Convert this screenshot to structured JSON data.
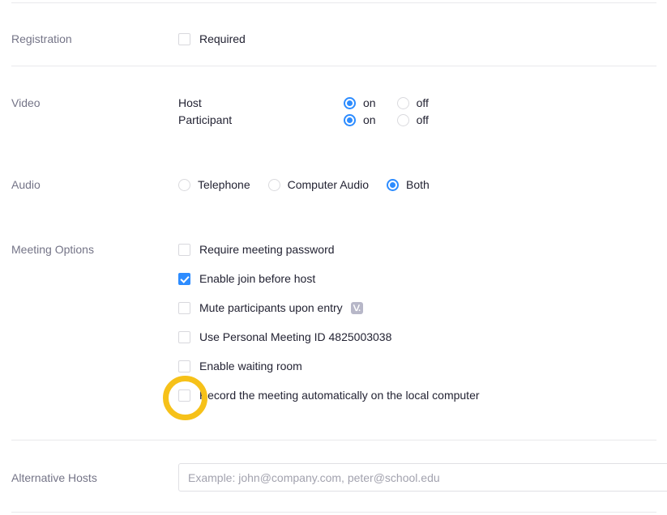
{
  "sections": {
    "registration": {
      "label": "Registration",
      "checkbox": {
        "label": "Required",
        "checked": false
      }
    },
    "video": {
      "label": "Video",
      "rows": [
        {
          "name": "Host",
          "options": [
            {
              "label": "on",
              "selected": true
            },
            {
              "label": "off",
              "selected": false
            }
          ]
        },
        {
          "name": "Participant",
          "options": [
            {
              "label": "on",
              "selected": true
            },
            {
              "label": "off",
              "selected": false
            }
          ]
        }
      ]
    },
    "audio": {
      "label": "Audio",
      "options": [
        {
          "label": "Telephone",
          "selected": false
        },
        {
          "label": "Computer Audio",
          "selected": false
        },
        {
          "label": "Both",
          "selected": true
        }
      ]
    },
    "meeting_options": {
      "label": "Meeting Options",
      "items": [
        {
          "label": "Require meeting password",
          "checked": false,
          "badge": null
        },
        {
          "label": "Enable join before host",
          "checked": true,
          "badge": null
        },
        {
          "label": "Mute participants upon entry",
          "checked": false,
          "badge": "license-badge-icon"
        },
        {
          "label": "Use Personal Meeting ID 4825003038",
          "checked": false,
          "badge": null
        },
        {
          "label": "Enable waiting room",
          "checked": false,
          "badge": null
        },
        {
          "label": "Record the meeting automatically on the local computer",
          "checked": false,
          "badge": null
        }
      ]
    },
    "alternative_hosts": {
      "label": "Alternative Hosts",
      "input": {
        "value": "",
        "placeholder": "Example: john@company.com, peter@school.edu"
      }
    }
  },
  "annotation": {
    "type": "highlight-ring",
    "target": "record-meeting-automatically-checkbox",
    "color": "#f6c119"
  },
  "colors": {
    "accent": "#2d8cff",
    "label": "#747487",
    "text": "#232333",
    "divider": "#e9e9ec",
    "placeholder": "#a2a2ae",
    "highlight": "#f6c119",
    "badge": "#b7b7c8"
  }
}
